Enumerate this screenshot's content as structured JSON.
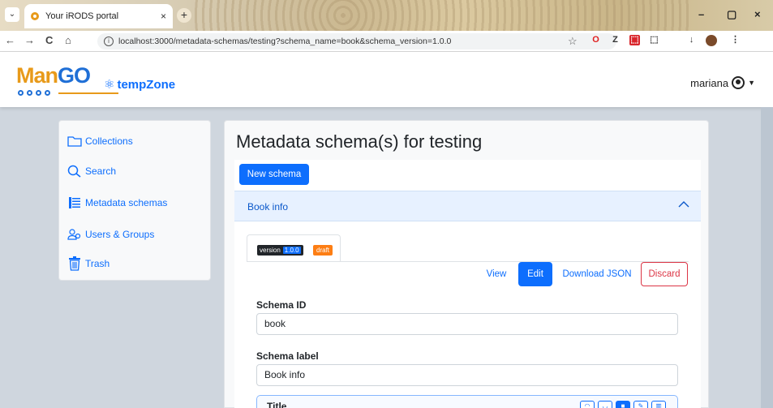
{
  "browser": {
    "tab_title": "Your iRODS portal",
    "tab_close": "×",
    "new_tab": "+",
    "tab_menu": "⌄",
    "url": "localhost:3000/metadata-schemas/testing?schema_name=book&schema_version=1.0.0",
    "window_controls": [
      "–",
      "▢",
      "×"
    ],
    "nav": [
      "←",
      "→",
      "C",
      "⌂"
    ],
    "extensions": [
      "O",
      "Z",
      "⬚",
      "⬚",
      "↓"
    ]
  },
  "app": {
    "logo_text_part1": "Man",
    "logo_text_part2": "GO",
    "zone_name": "tempZone",
    "user_name": "mariana"
  },
  "sidebar": {
    "items": [
      {
        "label": "Collections",
        "icon": "folder-icon"
      },
      {
        "label": "Search",
        "icon": "search-icon"
      },
      {
        "label": "Metadata schemas",
        "icon": "list-icon"
      },
      {
        "label": "Users & Groups",
        "icon": "users-icon"
      },
      {
        "label": "Trash",
        "icon": "trash-icon"
      }
    ]
  },
  "main": {
    "title": "Metadata schema(s) for testing",
    "new_schema_label": "New schema",
    "accordion_title": "Book info",
    "version_tag": "version",
    "version_number": "1.0.0",
    "status_badge": "draft",
    "actions": {
      "view": "View",
      "edit": "Edit",
      "download_json": "Download JSON",
      "discard": "Discard"
    },
    "fields": {
      "schema_id_label": "Schema ID",
      "schema_id_value": "book",
      "schema_label_label": "Schema label",
      "schema_label_value": "Book info"
    },
    "title_card_label": "Title"
  },
  "colors": {
    "primary": "#0d6efd",
    "danger": "#dc3545",
    "draft": "#fd7e14",
    "logo_orange": "#e89a1a",
    "logo_blue": "#1f6fd6"
  }
}
